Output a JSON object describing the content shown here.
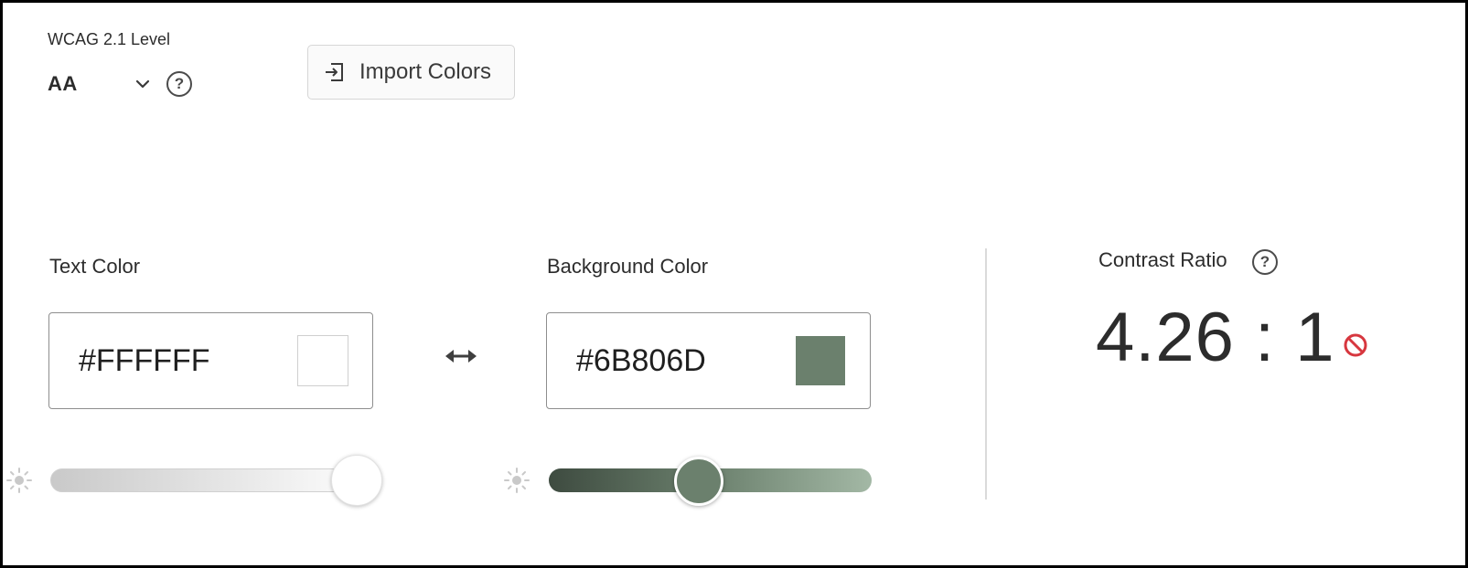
{
  "wcag": {
    "label": "WCAG 2.1 Level",
    "selected_level": "AA",
    "help_glyph": "?"
  },
  "import_button": {
    "label": "Import Colors",
    "icon": "import-icon"
  },
  "text_color": {
    "label": "Text Color",
    "value": "#FFFFFF",
    "swatch": "#FFFFFF",
    "brightness_slider_level": 1.0,
    "slider_gradient": [
      "#c9c9c9",
      "#ffffff"
    ],
    "slider_icon": "sun-icon"
  },
  "background_color": {
    "label": "Background Color",
    "value": "#6B806D",
    "swatch": "#6B806D",
    "brightness_slider_level": 0.5,
    "slider_gradient": [
      "#3e4b40",
      "#6B806D",
      "#a3b8a5"
    ],
    "slider_icon": "sun-icon"
  },
  "swap": {
    "icon": "swap-arrows-icon"
  },
  "contrast": {
    "label": "Contrast Ratio",
    "value": "4.26 : 1",
    "help_glyph": "?",
    "status_icon": "fail-icon",
    "status_color": "#d7373f"
  }
}
